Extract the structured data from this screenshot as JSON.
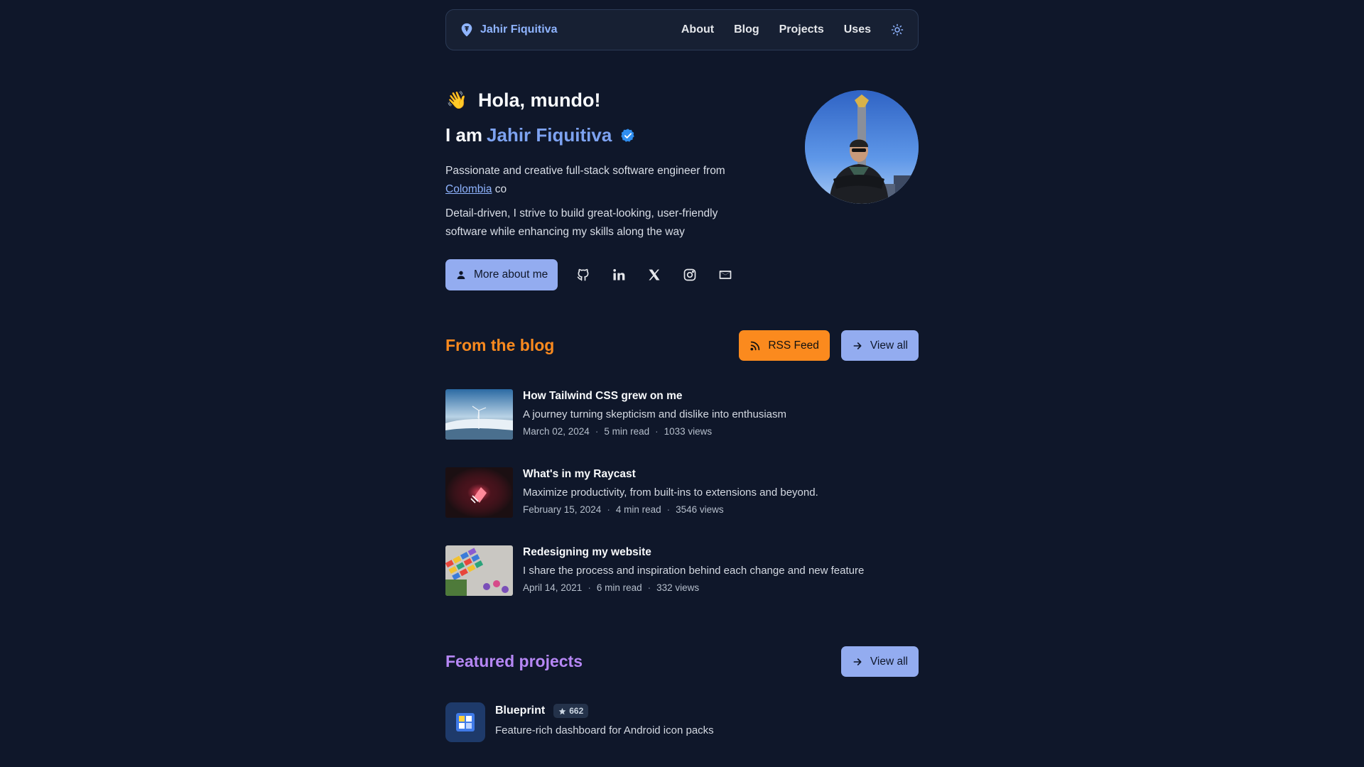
{
  "nav": {
    "brand": "Jahir Fiquitiva",
    "links": [
      "About",
      "Blog",
      "Projects",
      "Uses"
    ],
    "theme_icon": "sun-icon"
  },
  "hero": {
    "greeting_emoji": "👋",
    "greeting": "Hola, mundo!",
    "iam_prefix": "I am",
    "name": "Jahir Fiquitiva",
    "bio1_pre": "Passionate and creative full-stack software engineer from",
    "bio1_link": "Colombia",
    "bio1_flag": "co",
    "bio2": "Detail-driven, I strive to build great-looking, user-friendly software while enhancing my skills along the way",
    "more_button": "More about me",
    "socials": [
      "github-icon",
      "linkedin-icon",
      "x-icon",
      "instagram-icon",
      "mail-icon"
    ]
  },
  "blog": {
    "title": "From the blog",
    "title_color": "#fb8a1e",
    "rss_label": "RSS Feed",
    "view_all_label": "View all",
    "posts": [
      {
        "title": "How Tailwind CSS grew on me",
        "description": "A journey turning skepticism and dislike into enthusiasm",
        "date": "March 02, 2024",
        "read": "5 min read",
        "views": "1033 views"
      },
      {
        "title": "What's in my Raycast",
        "description": "Maximize productivity, from built-ins to extensions and beyond.",
        "date": "February 15, 2024",
        "read": "4 min read",
        "views": "3546 views"
      },
      {
        "title": "Redesigning my website",
        "description": "I share the process and inspiration behind each change and new feature",
        "date": "April 14, 2021",
        "read": "6 min read",
        "views": "332 views"
      }
    ]
  },
  "projects": {
    "title": "Featured projects",
    "title_color": "#b687f5",
    "view_all_label": "View all",
    "items": [
      {
        "name": "Blueprint",
        "stars": "662",
        "description": "Feature-rich dashboard for Android icon packs"
      }
    ]
  }
}
